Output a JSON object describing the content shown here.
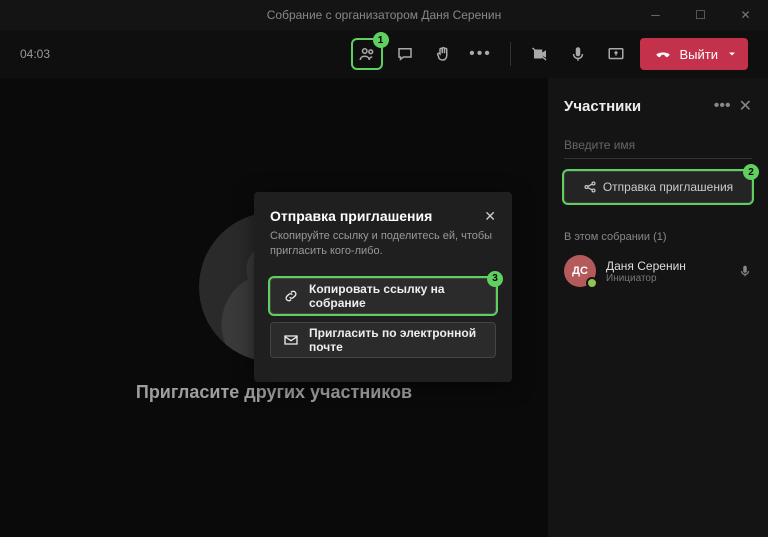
{
  "window": {
    "title": "Собрание с организатором Даня Серенин"
  },
  "toolbar": {
    "time": "04:03",
    "leave_label": "Выйти"
  },
  "main": {
    "invite_others": "Пригласите других участников"
  },
  "panel": {
    "title": "Участники",
    "name_placeholder": "Введите имя",
    "share_invite": "Отправка приглашения",
    "section_label": "В этом собрании (1)"
  },
  "participant": {
    "initials": "ДС",
    "name": "Даня Серенин",
    "role": "Инициатор"
  },
  "modal": {
    "title": "Отправка приглашения",
    "description": "Скопируйте ссылку и поделитесь ей, чтобы пригласить кого-либо.",
    "copy_link": "Копировать ссылку на собрание",
    "email_invite": "Пригласить по электронной почте"
  },
  "badges": {
    "b1": "1",
    "b2": "2",
    "b3": "3"
  }
}
